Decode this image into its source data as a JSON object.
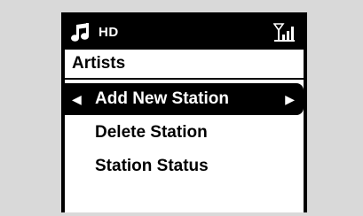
{
  "status_bar": {
    "title": "HD",
    "icons": {
      "left": "music-note-icon",
      "right": "signal-strength-icon"
    }
  },
  "header": {
    "title": "Artists"
  },
  "menu": {
    "items": [
      {
        "label": "Add New Station",
        "selected": true
      },
      {
        "label": "Delete Station",
        "selected": false
      },
      {
        "label": "Station Status",
        "selected": false
      }
    ],
    "arrows": {
      "left": "◀",
      "right": "▶"
    }
  },
  "colors": {
    "background": "#d9d9d9",
    "screen": "#ffffff",
    "highlight": "#000000",
    "text": "#000000",
    "highlight_text": "#ffffff"
  }
}
